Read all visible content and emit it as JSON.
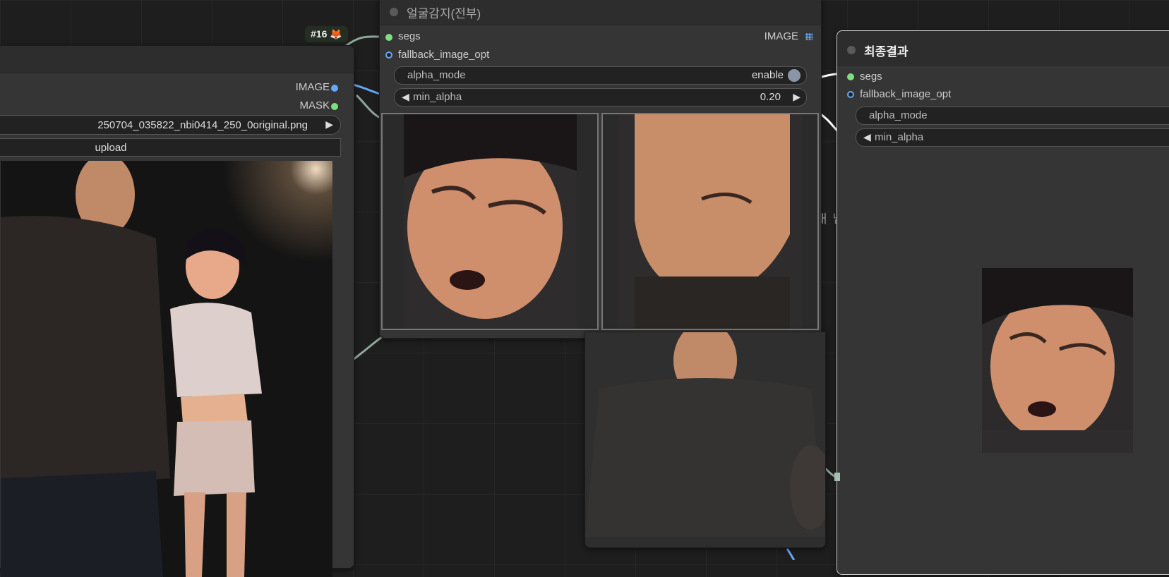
{
  "wires_color": "#65a8f5",
  "load_node": {
    "badge": "#16 🦊",
    "outputs": [
      {
        "label": "IMAGE",
        "color": "#65a8f5"
      },
      {
        "label": "MASK",
        "color": "#7fe07f"
      }
    ],
    "filename": "250704_035822_nbi0414_250_0original.png",
    "upload_label": "upload"
  },
  "detect_node": {
    "title": "얼굴감지(전부)",
    "inputs": [
      "segs",
      "fallback_image_opt"
    ],
    "output": "IMAGE",
    "alpha_mode": {
      "label": "alpha_mode",
      "value": "enable"
    },
    "min_alpha": {
      "label": "min_alpha",
      "value": "0.20"
    }
  },
  "result_node": {
    "title": "최종결과",
    "inputs": [
      "segs",
      "fallback_image_opt"
    ],
    "alpha_mode_label": "alpha_mode",
    "min_alpha_label": "min_alpha"
  },
  "occluded_text": "ㅐ 님"
}
